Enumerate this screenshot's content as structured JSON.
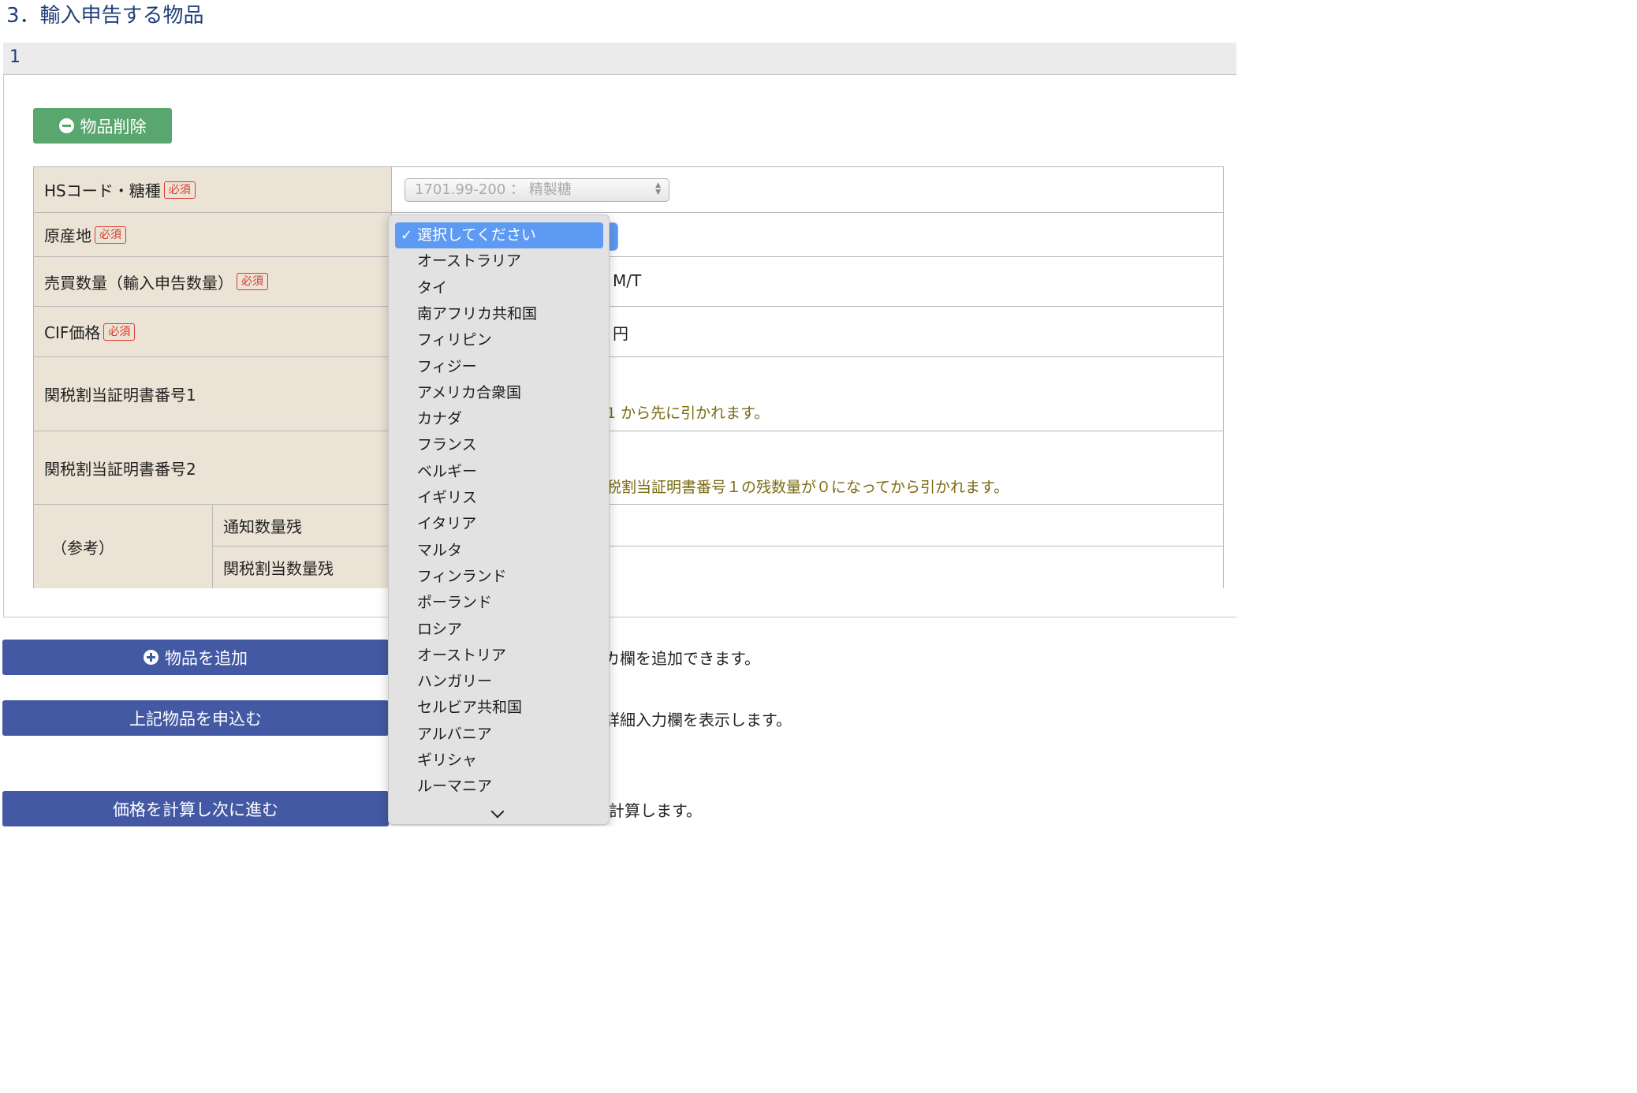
{
  "section_title": "3．輸入申告する物品",
  "item_number": "1",
  "delete_button_label": "物品削除",
  "required_badge": "必須",
  "rows": {
    "hs_code_label": "HSコード・糖種",
    "hs_code_value": "1701.99-200 ： 精製糖",
    "origin_label": "原産地",
    "quantity_label": "売買数量（輸入申告数量）",
    "quantity_unit": "M/T",
    "cif_label": "CIF価格",
    "cif_unit": "円",
    "cert1_label": "関税割当証明書番号1",
    "cert1_note": "1 から先に引かれます。",
    "cert2_label": "関税割当証明書番号2",
    "cert2_note": "税割当証明書番号１の残数量が０になってから引かれます。",
    "reference_label": "（参考）",
    "notice_qty_label": "通知数量残",
    "quota_qty_label": "関税割当数量残"
  },
  "buttons": {
    "add_item": "物品を追加",
    "apply_items": "上記物品を申込む",
    "calc_next": "価格を計算し次に進む"
  },
  "descriptions": {
    "add_item": "カ欄を追加できます。",
    "apply_items": "詳細入力欄を表示します。",
    "calc_next": "計算します。"
  },
  "origin_dropdown": {
    "selected": "選択してください",
    "options": [
      "選択してください",
      "オーストラリア",
      "タイ",
      "南アフリカ共和国",
      "フィリピン",
      "フィジー",
      "アメリカ合衆国",
      "カナダ",
      "フランス",
      "ベルギー",
      "イギリス",
      "イタリア",
      "マルタ",
      "フィンランド",
      "ポーランド",
      "ロシア",
      "オーストリア",
      "ハンガリー",
      "セルビア共和国",
      "アルバニア",
      "ギリシャ",
      "ルーマニア"
    ]
  },
  "colors": {
    "title": "#1f3f7a",
    "delete_button": "#5aa66f",
    "action_button": "#4459a4",
    "required": "#d93a2b",
    "label_bg": "#ebe3d5",
    "note": "#7b6a12",
    "dropdown_highlight": "#5d9af3"
  }
}
